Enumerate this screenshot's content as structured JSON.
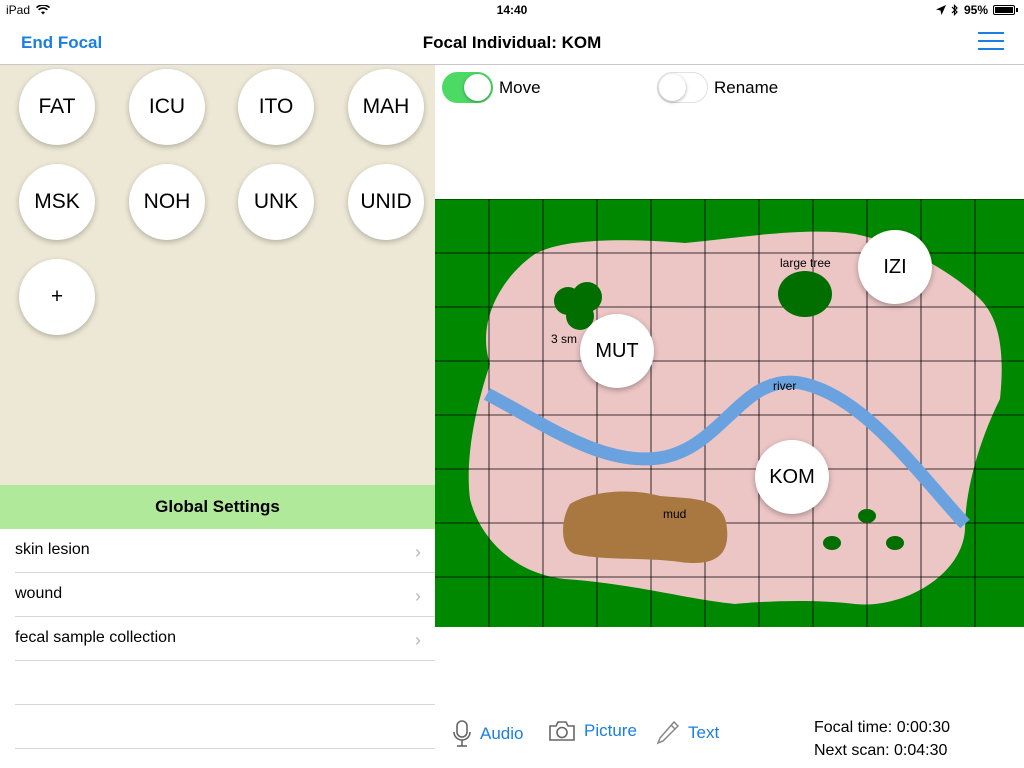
{
  "status_bar": {
    "device": "iPad",
    "time": "14:40",
    "battery": "95%"
  },
  "nav": {
    "left_button": "End Focal",
    "title": "Focal Individual: KOM",
    "menu_icon": "hamburger-menu-icon"
  },
  "individuals": [
    "FAT",
    "ICU",
    "ITO",
    "MAH",
    "MSK",
    "NOH",
    "UNK",
    "UNID"
  ],
  "add_button": "+",
  "global_settings": {
    "header": "Global Settings",
    "items": [
      "skin lesion",
      "wound",
      "fecal sample collection"
    ]
  },
  "toggles": {
    "move": {
      "label": "Move",
      "on": true
    },
    "rename": {
      "label": "Rename",
      "on": false
    }
  },
  "map": {
    "labels": {
      "large_tree": "large tree",
      "small_trees": "3 sm",
      "river": "river",
      "mud": "mud"
    },
    "individuals": {
      "izi": "IZI",
      "mut": "MUT",
      "kom": "KOM"
    },
    "colors": {
      "grass": "#008800",
      "ground": "#ecc5c5",
      "river": "#6aa2e0",
      "mud": "#a97840",
      "tree": "#006f00"
    }
  },
  "toolbar": {
    "audio": "Audio",
    "picture": "Picture",
    "text": "Text"
  },
  "timers": {
    "focal_time": "Focal time: 0:00:30",
    "next_scan": "Next scan: 0:04:30"
  }
}
